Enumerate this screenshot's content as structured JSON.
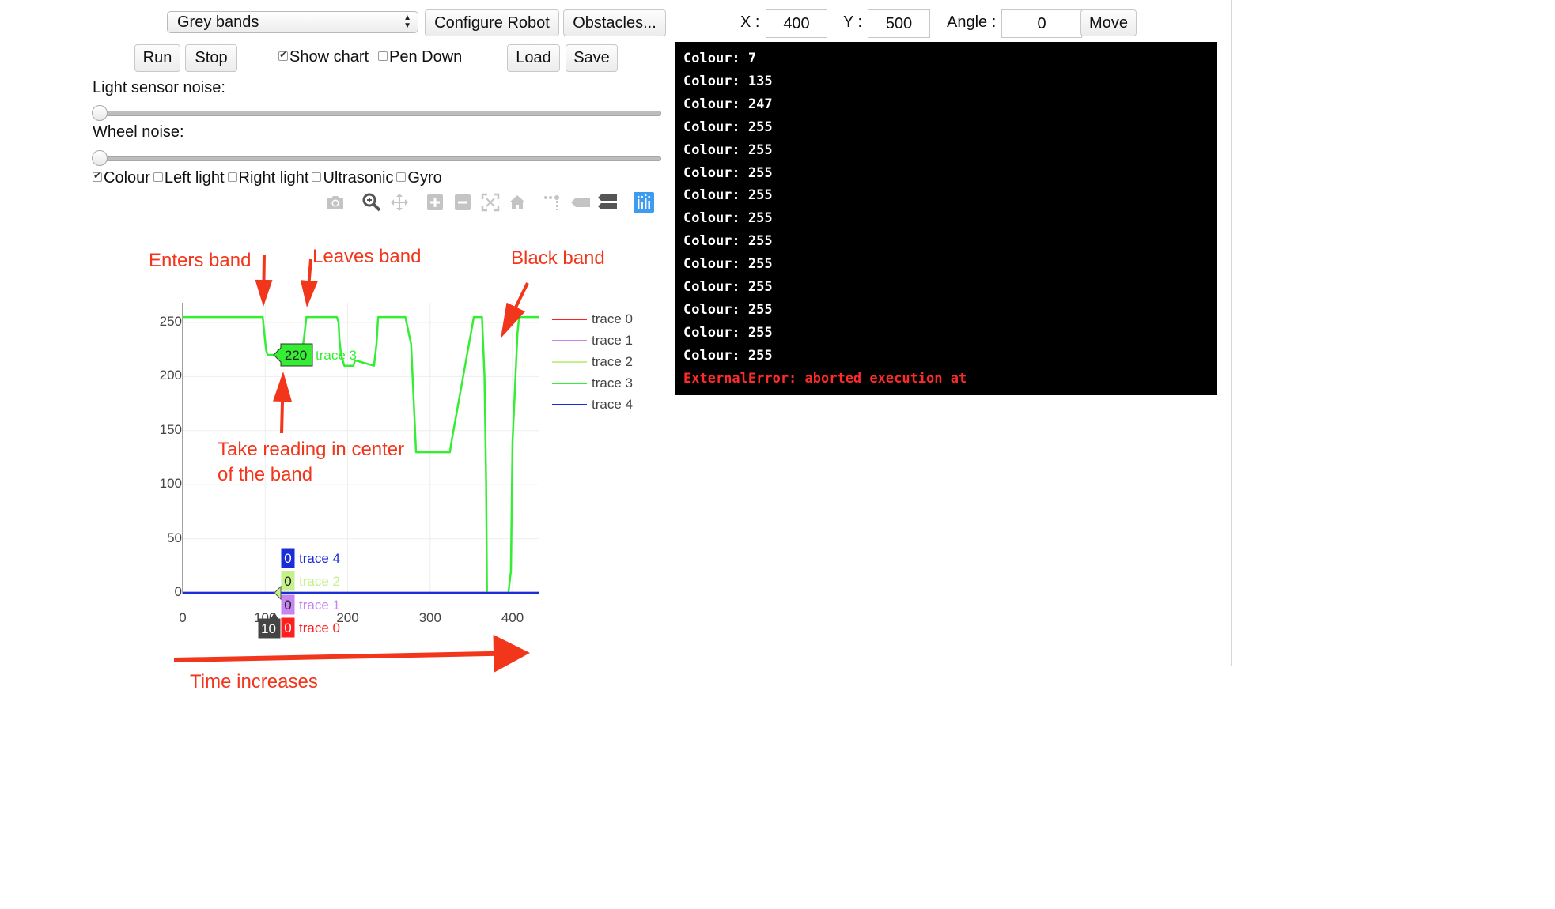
{
  "toolbar": {
    "scenario_select": "Grey bands",
    "configure_robot": "Configure Robot",
    "obstacles": "Obstacles...",
    "run": "Run",
    "stop": "Stop",
    "show_chart": {
      "label": "Show chart",
      "checked": true
    },
    "pen_down": {
      "label": "Pen Down",
      "checked": false
    },
    "load": "Load",
    "save": "Save"
  },
  "position": {
    "x_label": "X :",
    "x_value": "400",
    "y_label": "Y :",
    "y_value": "500",
    "angle_label": "Angle :",
    "angle_value": "0",
    "move": "Move"
  },
  "sliders": {
    "light_noise": {
      "label": "Light sensor noise:",
      "value": 0
    },
    "wheel_noise": {
      "label": "Wheel noise:",
      "value": 0
    }
  },
  "sensors": [
    {
      "label": "Colour",
      "checked": true
    },
    {
      "label": "Left light",
      "checked": false
    },
    {
      "label": "Right light",
      "checked": false
    },
    {
      "label": "Ultrasonic",
      "checked": false
    },
    {
      "label": "Gyro",
      "checked": false
    }
  ],
  "modebar": [
    "camera-icon",
    "zoom-icon",
    "pan-icon",
    "zoom-in-icon",
    "zoom-out-icon",
    "autoscale-icon",
    "reset-axes-icon",
    "spike-lines-icon",
    "hover-closest-icon",
    "hover-compare-icon",
    "plotly-logo-icon"
  ],
  "console": {
    "lines": [
      "Colour: 7",
      "Colour: 135",
      "Colour: 247",
      "Colour: 255",
      "Colour: 255",
      "Colour: 255",
      "Colour: 255",
      "Colour: 255",
      "Colour: 255",
      "Colour: 255",
      "Colour: 255",
      "Colour: 255",
      "Colour: 255",
      "Colour: 255"
    ],
    "error": "ExternalError: aborted execution at"
  },
  "annotations": {
    "enters_band": "Enters band",
    "leaves_band": "Leaves band",
    "black_band": "Black band",
    "take_reading_1": "Take reading in center",
    "take_reading_2": "of the band",
    "time_increases": "Time increases"
  },
  "chart_data": {
    "type": "line",
    "title": "",
    "xlabel": "",
    "ylabel": "",
    "xlim": [
      0,
      432
    ],
    "ylim": [
      0,
      262
    ],
    "x_ticks": [
      0,
      100,
      200,
      300,
      400
    ],
    "y_ticks": [
      0,
      50,
      100,
      150,
      200,
      250
    ],
    "grid": true,
    "legend_position": "right",
    "series": [
      {
        "name": "trace 0",
        "color": "#ff1f1f",
        "x": [
          0,
          432
        ],
        "y": [
          0,
          0
        ]
      },
      {
        "name": "trace 1",
        "color": "#c586f0",
        "x": [
          0,
          432
        ],
        "y": [
          0,
          0
        ]
      },
      {
        "name": "trace 2",
        "color": "#c5f08a",
        "x": [
          0,
          432
        ],
        "y": [
          0,
          0
        ]
      },
      {
        "name": "trace 3",
        "color": "#33ee33",
        "x": [
          0,
          97,
          99,
          101,
          103,
          115,
          116,
          145,
          147,
          150,
          187,
          189,
          190,
          192,
          196,
          207,
          209,
          232,
          235,
          237,
          249,
          270,
          277,
          280,
          283,
          303,
          324,
          326,
          353,
          363,
          366,
          368,
          369,
          395,
          398,
          400,
          406,
          408,
          412,
          432
        ],
        "y": [
          255,
          255,
          240,
          225,
          220,
          220,
          225,
          225,
          235,
          255,
          255,
          250,
          235,
          220,
          210,
          210,
          215,
          210,
          230,
          255,
          255,
          255,
          230,
          180,
          130,
          130,
          130,
          140,
          255,
          255,
          200,
          100,
          0,
          0,
          20,
          140,
          240,
          255,
          255,
          255
        ]
      },
      {
        "name": "trace 4",
        "color": "#1a2ed8",
        "x": [
          0,
          432
        ],
        "y": [
          0,
          0
        ]
      }
    ],
    "hover": {
      "x_label": "10",
      "labels": [
        {
          "series": "trace 3",
          "value": "220"
        },
        {
          "series": "trace 4",
          "value": "0"
        },
        {
          "series": "trace 2",
          "value": "0"
        },
        {
          "series": "trace 1",
          "value": "0"
        },
        {
          "series": "trace 0",
          "value": "0"
        }
      ]
    }
  }
}
